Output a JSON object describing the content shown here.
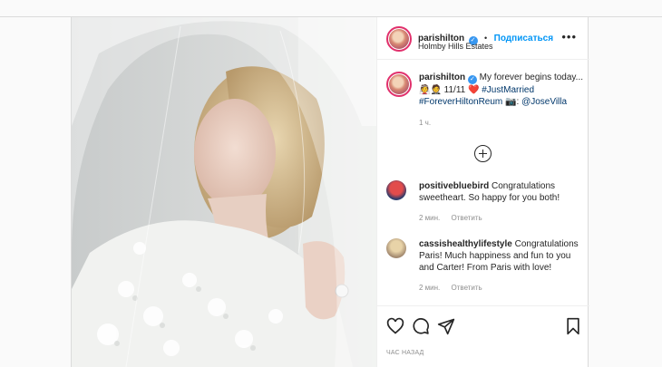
{
  "header": {
    "username": "parishilton",
    "dot": "•",
    "follow_label": "Подписаться",
    "location": "Holmby Hills Estates",
    "more_label": "•••"
  },
  "caption": {
    "username": "parishilton",
    "text_1": " My forever begins today...",
    "emoji_line": "👰🤵 11/11 ❤️",
    "tag_1": "#JustMarried",
    "tag_2": "#ForeverHiltonReum",
    "camera": " 📷: ",
    "mention": "@JoseVilla",
    "time": "1 ч."
  },
  "comments": [
    {
      "username": "positivebluebird",
      "text": " Congratulations sweetheart. So happy for you both!",
      "time": "2 мин.",
      "reply": "Ответить"
    },
    {
      "username": "cassishealthylifestyle",
      "text": " Congratulations Paris! Much happiness and fun to you and Carter! From Paris with love!",
      "time": "2 мин.",
      "reply": "Ответить"
    }
  ],
  "footer": {
    "time_label": "ЧАС НАЗАД"
  },
  "colors": {
    "accent": "#0095f6",
    "verified": "#3897f0",
    "border": "#dbdbdb"
  }
}
